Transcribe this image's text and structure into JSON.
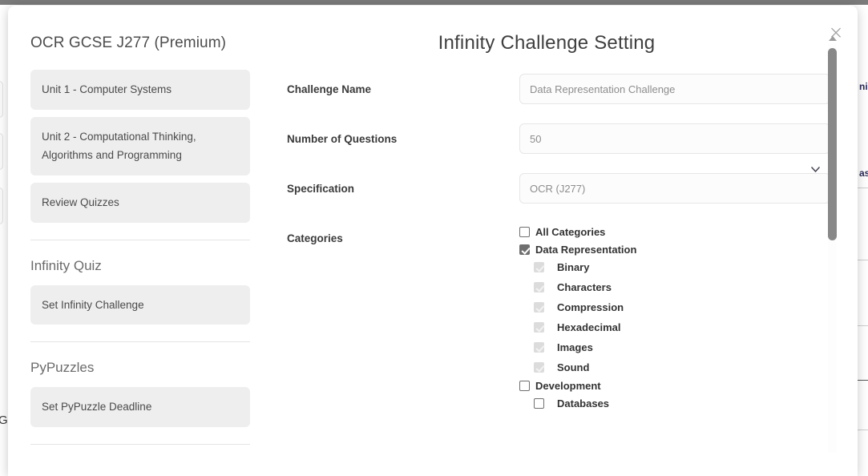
{
  "backdrop": {
    "right_fragments": [
      "ni",
      "as"
    ],
    "left_fragment": "G"
  },
  "modal": {
    "title": "Infinity Challenge Setting",
    "close_label": "×"
  },
  "sidebar": {
    "title": "OCR GCSE J277 (Premium)",
    "items": [
      {
        "label": "Unit 1 - Computer Systems"
      },
      {
        "label": "Unit 2 - Computational Thinking, Algorithms and Programming"
      },
      {
        "label": "Review Quizzes"
      }
    ],
    "sections": [
      {
        "title": "Infinity Quiz",
        "items": [
          {
            "label": "Set Infinity Challenge"
          }
        ]
      },
      {
        "title": "PyPuzzles",
        "items": [
          {
            "label": "Set PyPuzzle Deadline"
          }
        ]
      }
    ]
  },
  "form": {
    "fields": [
      {
        "label": "Challenge Name",
        "type": "text",
        "value": "",
        "placeholder": "Data Representation Challenge"
      },
      {
        "label": "Number of Questions",
        "type": "text",
        "value": "",
        "placeholder": "50"
      },
      {
        "label": "Specification",
        "type": "select",
        "value": "OCR (J277)",
        "options": [
          "OCR (J277)"
        ]
      }
    ],
    "categories": {
      "label": "Categories",
      "items": [
        {
          "label": "All Categories",
          "level": 0,
          "checked": false,
          "disabled": false
        },
        {
          "label": "Data Representation",
          "level": 0,
          "checked": true,
          "disabled": false
        },
        {
          "label": "Binary",
          "level": 1,
          "checked": true,
          "disabled": true
        },
        {
          "label": "Characters",
          "level": 1,
          "checked": true,
          "disabled": true
        },
        {
          "label": "Compression",
          "level": 1,
          "checked": true,
          "disabled": true
        },
        {
          "label": "Hexadecimal",
          "level": 1,
          "checked": true,
          "disabled": true
        },
        {
          "label": "Images",
          "level": 1,
          "checked": true,
          "disabled": true
        },
        {
          "label": "Sound",
          "level": 1,
          "checked": true,
          "disabled": true
        },
        {
          "label": "Development",
          "level": 0,
          "checked": false,
          "disabled": false
        },
        {
          "label": "Databases",
          "level": 1,
          "checked": false,
          "disabled": false
        }
      ]
    }
  },
  "colors": {
    "overlay": "#7b7b7b",
    "modal_bg": "#ffffff",
    "sidebar_item_bg": "#eeeeee",
    "input_border": "#e6e6e6",
    "checkbox_checked": "#6f6f6f",
    "checkbox_disabled": "#dcdcdc",
    "scrollbar_thumb": "#888888"
  }
}
